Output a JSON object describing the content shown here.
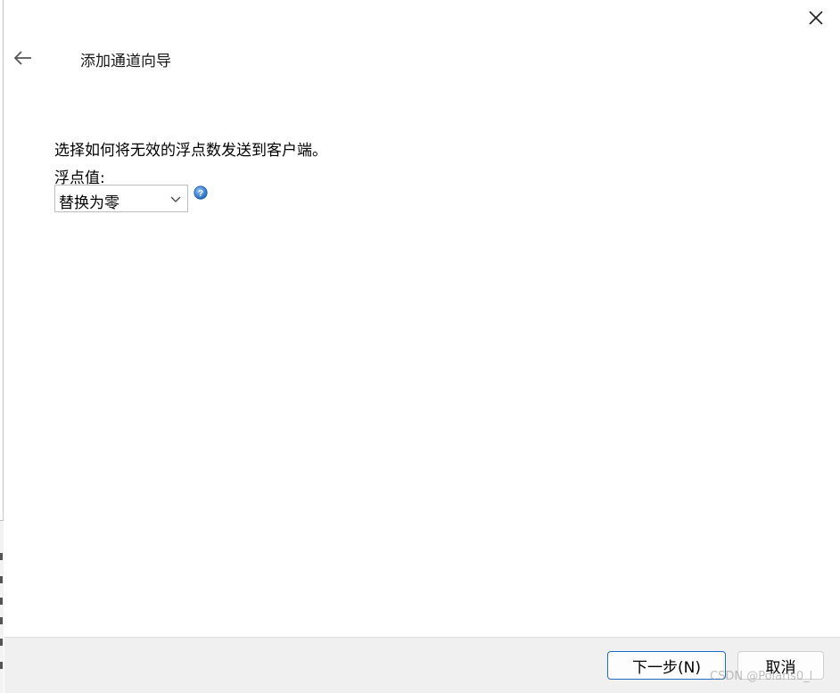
{
  "wizard": {
    "title": "添加通道向导"
  },
  "step": {
    "instruction": "选择如何将无效的浮点数发送到客户端。",
    "field_label": "浮点值:",
    "select_value": "替换为零"
  },
  "footer": {
    "next_label": "下一步(N)",
    "cancel_label": "取消"
  },
  "watermark": "CSDN @Polaris0_l",
  "icons": {
    "back": "back-arrow-icon",
    "close": "close-icon",
    "help": "help-icon",
    "dropdown": "chevron-down-icon"
  },
  "colors": {
    "primary_border": "#1c6cc7",
    "help_icon": "#2f7fd6",
    "footer_bg": "#f0f0f0"
  }
}
